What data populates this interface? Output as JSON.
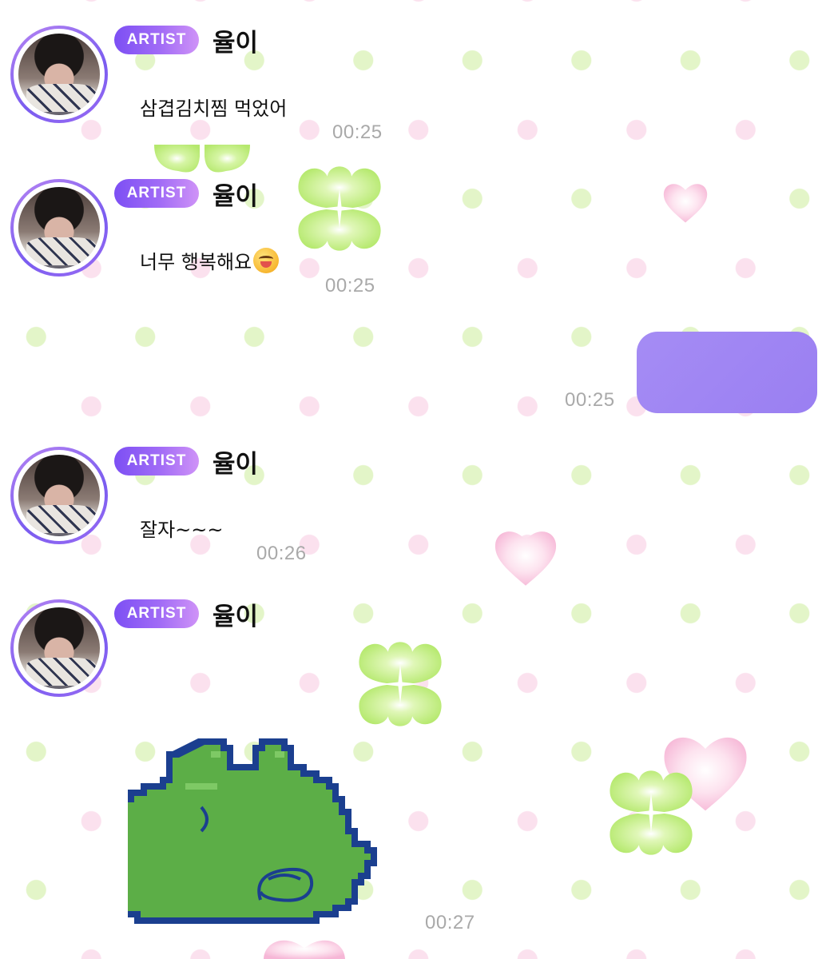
{
  "colors": {
    "badge_start": "#7c4ff4",
    "badge_end": "#cf93f7",
    "my_bubble": "#9f85f3",
    "timestamp": "#a9a9a9"
  },
  "messages": [
    {
      "badge": "ARTIST",
      "sender": "율이",
      "text": "삼겹김치찜 먹었어",
      "time": "00:25"
    },
    {
      "badge": "ARTIST",
      "sender": "율이",
      "text": "너무 행복해요",
      "emoji": "yum-face-emoji",
      "time": "00:25"
    },
    {
      "badge": "ARTIST",
      "sender": "율이",
      "text": "잘자~~~",
      "time": "00:26"
    },
    {
      "badge": "ARTIST",
      "sender": "율이",
      "sticker": "green-pixel-frog-sticker",
      "time": "00:27"
    }
  ],
  "my_message": {
    "time": "00:25"
  },
  "icons": {
    "avatar": "artist-avatar",
    "decorations": [
      "clover-icon",
      "heart-icon"
    ]
  }
}
